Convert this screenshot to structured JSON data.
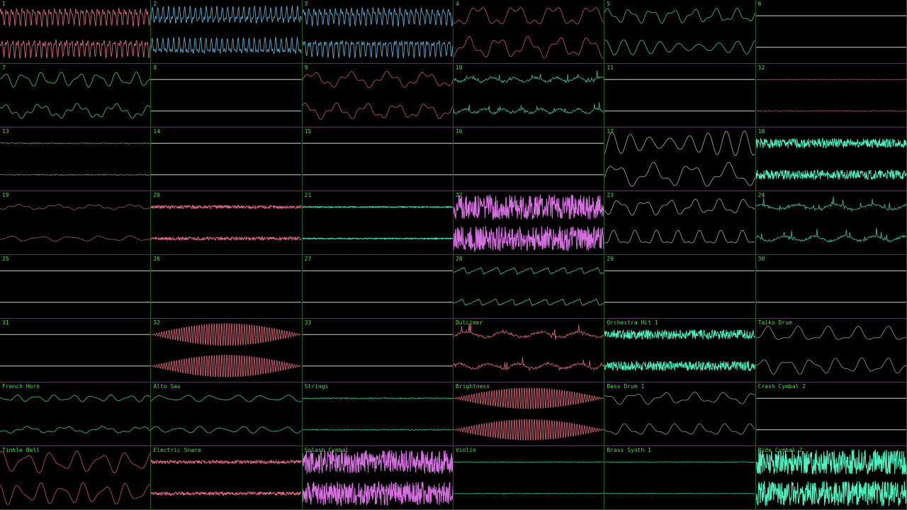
{
  "channels": [
    {
      "label": "1",
      "color": "#d06b7a",
      "style": "dense",
      "amp": 0.75,
      "level": 0.55
    },
    {
      "label": "2",
      "color": "#5ea8c8",
      "style": "dense",
      "amp": 0.7,
      "level": 0.55
    },
    {
      "label": "3",
      "color": "#5ea8c8",
      "style": "dense",
      "amp": 0.75,
      "level": 0.55
    },
    {
      "label": "4",
      "color": "#b05060",
      "style": "wave",
      "amp": 0.8,
      "level": 0.45
    },
    {
      "label": "5",
      "color": "#3fae8c",
      "style": "wave",
      "amp": 0.55,
      "level": 0.45
    },
    {
      "label": "6",
      "color": "#c8c8c8",
      "style": "flat",
      "amp": 0.0,
      "level": 0.0
    },
    {
      "label": "7",
      "color": "#3fae8c",
      "style": "wave",
      "amp": 0.55,
      "level": 0.4
    },
    {
      "label": "8",
      "color": "#c8c8c8",
      "style": "flat",
      "amp": 0.0,
      "level": 0.0
    },
    {
      "label": "9",
      "color": "#b05060",
      "style": "wave",
      "amp": 0.6,
      "level": 0.45
    },
    {
      "label": "10",
      "color": "#3fae8c",
      "style": "spiky",
      "amp": 0.5,
      "level": 0.4
    },
    {
      "label": "11",
      "color": "#c8c8c8",
      "style": "flat",
      "amp": 0.0,
      "level": 0.0
    },
    {
      "label": "12",
      "color": "#8a5560",
      "style": "quiet",
      "amp": 0.05,
      "level": 0.1
    },
    {
      "label": "13",
      "color": "#6f7f6f",
      "style": "quiet",
      "amp": 0.08,
      "level": 0.1
    },
    {
      "label": "14",
      "color": "#c8c8c8",
      "style": "flat",
      "amp": 0.0,
      "level": 0.0
    },
    {
      "label": "15",
      "color": "#c8c8c8",
      "style": "flat",
      "amp": 0.0,
      "level": 0.0
    },
    {
      "label": "16",
      "color": "#c8c8c8",
      "style": "flat",
      "amp": 0.0,
      "level": 0.0
    },
    {
      "label": "17",
      "color": "#9a9a9a",
      "style": "wave",
      "amp": 0.9,
      "level": 0.5
    },
    {
      "label": "18",
      "color": "#4ff0c0",
      "style": "noise",
      "amp": 0.35,
      "level": 0.5
    },
    {
      "label": "19",
      "color": "#8a5560",
      "style": "wave",
      "amp": 0.2,
      "level": 0.15
    },
    {
      "label": "20",
      "color": "#e06c8a",
      "style": "noise",
      "amp": 0.12,
      "level": 0.3
    },
    {
      "label": "21",
      "color": "#4ff0c0",
      "style": "noise",
      "amp": 0.04,
      "level": 0.2
    },
    {
      "label": "22",
      "color": "#d670e0",
      "style": "noise",
      "amp": 0.9,
      "level": 0.95
    },
    {
      "label": "23",
      "color": "#9a9a9a",
      "style": "wave",
      "amp": 0.6,
      "level": 0.4
    },
    {
      "label": "24",
      "color": "#3fae8c",
      "style": "spiky",
      "amp": 0.55,
      "level": 0.45
    },
    {
      "label": "25",
      "color": "#c8c8c8",
      "style": "flat",
      "amp": 0.0,
      "level": 0.0
    },
    {
      "label": "26",
      "color": "#c8c8c8",
      "style": "flat",
      "amp": 0.0,
      "level": 0.0
    },
    {
      "label": "27",
      "color": "#c8c8c8",
      "style": "flat",
      "amp": 0.0,
      "level": 0.0
    },
    {
      "label": "28",
      "color": "#3fae8c",
      "style": "saw",
      "amp": 0.45,
      "level": 0.4
    },
    {
      "label": "29",
      "color": "#c8c8c8",
      "style": "flat",
      "amp": 0.0,
      "level": 0.0
    },
    {
      "label": "30",
      "color": "#c8c8c8",
      "style": "flat",
      "amp": 0.0,
      "level": 0.0
    },
    {
      "label": "31",
      "color": "#c8c8c8",
      "style": "flat",
      "amp": 0.0,
      "level": 0.0
    },
    {
      "label": "32",
      "color": "#c86070",
      "style": "burst",
      "amp": 0.9,
      "level": 0.6
    },
    {
      "label": "33",
      "color": "#c8c8c8",
      "style": "flat",
      "amp": 0.0,
      "level": 0.0
    },
    {
      "label": "Dulcimer",
      "color": "#c86070",
      "style": "spiky",
      "amp": 0.6,
      "level": 0.5
    },
    {
      "label": "Orchestra Hit 1",
      "color": "#4ff0c0",
      "style": "noise",
      "amp": 0.35,
      "level": 0.55
    },
    {
      "label": "Taiko Drum",
      "color": "#8a8a8a",
      "style": "wave",
      "amp": 0.6,
      "level": 0.4
    },
    {
      "label": "French Horn",
      "color": "#3fae8c",
      "style": "wave",
      "amp": 0.25,
      "level": 0.25
    },
    {
      "label": "Alto Sax",
      "color": "#3fae8c",
      "style": "wave",
      "amp": 0.25,
      "level": 0.25
    },
    {
      "label": "Strings",
      "color": "#3fae8c",
      "style": "quiet",
      "amp": 0.08,
      "level": 0.15
    },
    {
      "label": "Brightness",
      "color": "#c86070",
      "style": "burst",
      "amp": 0.85,
      "level": 0.6
    },
    {
      "label": "Bass Drum 1",
      "color": "#8a8a8a",
      "style": "wave",
      "amp": 0.45,
      "level": 0.35
    },
    {
      "label": "Crash Cymbal 2",
      "color": "#c8c8c8",
      "style": "flat",
      "amp": 0.0,
      "level": 0.0
    },
    {
      "label": "Tinkle Bell",
      "color": "#b05060",
      "style": "wave",
      "amp": 0.8,
      "level": 0.5
    },
    {
      "label": "Electric Snare",
      "color": "#e06c8a",
      "style": "noise",
      "amp": 0.12,
      "level": 0.3
    },
    {
      "label": "Splash Cymbal",
      "color": "#d670e0",
      "style": "noise",
      "amp": 0.85,
      "level": 0.95
    },
    {
      "label": "Violin",
      "color": "#3fae8c",
      "style": "quiet",
      "amp": 0.05,
      "level": 0.12
    },
    {
      "label": "Brass Synth 1",
      "color": "#3fae8c",
      "style": "quiet",
      "amp": 0.05,
      "level": 0.12
    },
    {
      "label": "Ride Cymbal 2",
      "color": "#4ff0c0",
      "style": "noise",
      "amp": 0.9,
      "level": 0.95
    }
  ]
}
